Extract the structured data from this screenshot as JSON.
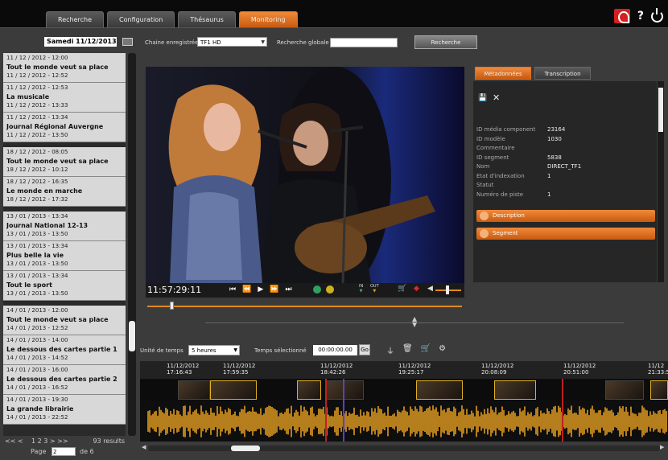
{
  "tabs": [
    "Recherche",
    "Configuration",
    "Thésaurus",
    "Monitoring"
  ],
  "active_tab": "Monitoring",
  "search": {
    "date": "Samedi 11/12/2013",
    "channel_label": "Chaine enregistrée",
    "channel_value": "TF1 HD",
    "global_label": "Recherche globale",
    "global_value": "",
    "button": "Recherche"
  },
  "list": [
    {
      "start": "11 / 12 / 2012 - 12:00",
      "title": "Tout le monde veut sa place",
      "end": "11 / 12 / 2012 - 12:52"
    },
    {
      "start": "11 / 12 / 2012 - 12:53",
      "title": "La musicale",
      "end": "11 / 12 / 2012 - 13:33"
    },
    {
      "start": "11 / 12 / 2012 - 13:34",
      "title": "Journal Régional Auvergne",
      "end": "11 / 12 / 2012 - 13:50"
    },
    {
      "start": "18 / 12 / 2012 - 08:05",
      "title": "Tout le monde veut sa place",
      "end": "18 / 12 / 2012 - 10:12"
    },
    {
      "start": "18 / 12 / 2012 - 16:35",
      "title": "Le monde en marche",
      "end": "18 / 12 / 2012 - 17:32"
    },
    {
      "start": "13 / 01 / 2013 - 13:34",
      "title": "Journal National 12-13",
      "end": "13 / 01 / 2013 - 13:50"
    },
    {
      "start": "13 / 01 / 2013 - 13:34",
      "title": "Plus belle la vie",
      "end": "13 / 01 / 2013 - 13:50"
    },
    {
      "start": "13 / 01 / 2013 - 13:34",
      "title": "Tout le sport",
      "end": "13 / 01 / 2013 - 13:50"
    },
    {
      "start": "14 / 01 / 2013 - 12:00",
      "title": "Tout le monde veut sa place",
      "end": "14 / 01 / 2013 - 12:52"
    },
    {
      "start": "14 / 01 / 2013 - 14:00",
      "title": "Le dessous des cartes partie 1",
      "end": "14 / 01 / 2013 - 14:52"
    },
    {
      "start": "14 / 01 / 2013 - 16:00",
      "title": "Le dessous des cartes partie 2",
      "end": "14 / 01 / 2013 - 16:52"
    },
    {
      "start": "14 / 01 / 2013 - 19:30",
      "title": "La grande librairie",
      "end": "14 / 01 / 2013 - 22:52"
    }
  ],
  "pager": {
    "nav": "<<  <",
    "pages": "1 2 3",
    "nav2": ">  >>",
    "results": "93 results",
    "page_label": "Page",
    "page_value": "2",
    "of_label": "de 6"
  },
  "player": {
    "timecode": "11:57:29:11",
    "in_label": "IN",
    "out_label": "OUT",
    "slider_fraction": 0.08
  },
  "meta": {
    "tab1": "Métadonnées",
    "tab2": "Transcription",
    "rows": [
      {
        "k": "ID média component",
        "v": "23164"
      },
      {
        "k": "ID modèle",
        "v": "1030"
      },
      {
        "k": "Commentaire",
        "v": ""
      },
      {
        "k": "ID segment",
        "v": "5838"
      },
      {
        "k": "Nom",
        "v": "DIRECT_TF1"
      },
      {
        "k": "Etat d'indexation",
        "v": "1"
      },
      {
        "k": "Statut",
        "v": ""
      },
      {
        "k": "Numéro de piste",
        "v": "1"
      }
    ],
    "sec1": "Description",
    "sec2": "Segment"
  },
  "tools": {
    "unit_label": "Unité de temps",
    "unit_value": "5 heures",
    "sel_label": "Temps sélectionné",
    "sel_value": "00:00:00.00",
    "ok": "Go"
  },
  "timeline": {
    "ticks": [
      {
        "d": "11/12/2012",
        "t": "17:16:43"
      },
      {
        "d": "11/12/2012",
        "t": "17:59:35"
      },
      {
        "d": "11/12/2012",
        "t": "18:42:26"
      },
      {
        "d": "11/12/2012",
        "t": "19:25:17"
      },
      {
        "d": "11/12/2012",
        "t": "20:08:09"
      },
      {
        "d": "11/12/2012",
        "t": "20:51:00"
      },
      {
        "d": "11/12",
        "t": "21:33:5"
      }
    ]
  },
  "colors": {
    "accent": "#e07020",
    "waveform": "#e09a20",
    "marker_red": "#c02020",
    "marker_purple": "#6040c0"
  }
}
